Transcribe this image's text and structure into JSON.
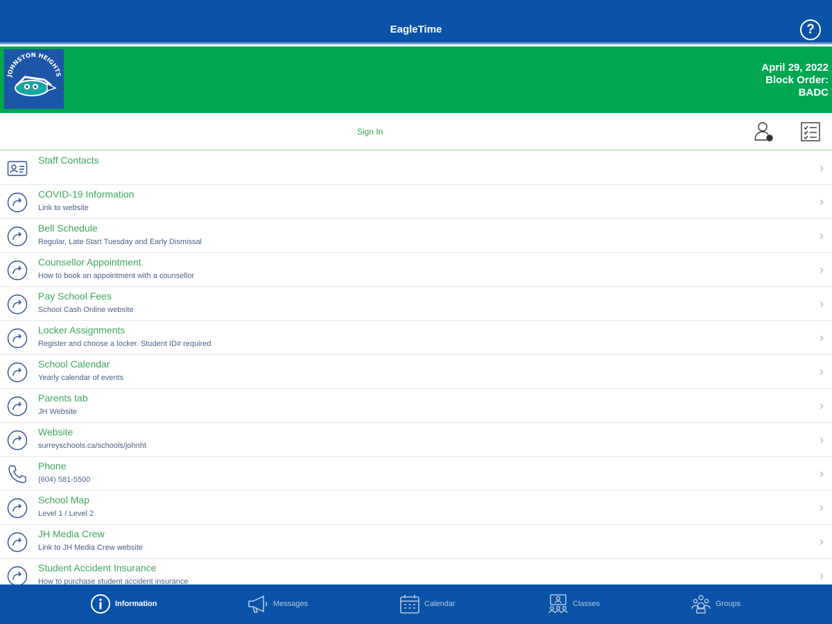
{
  "header": {
    "title": "EagleTime",
    "help_icon": "help-circle-icon"
  },
  "banner": {
    "logo_text": "JOHNSTON HEIGHTS",
    "date": "April 29, 2022",
    "block_order_label": "Block Order:",
    "block_order_value": "BADC"
  },
  "signin": {
    "label": "Sign In"
  },
  "items": [
    {
      "title": "Staff Contacts",
      "subtitle": "",
      "icon": "contact-card-icon"
    },
    {
      "title": "COVID-19 Information",
      "subtitle": "Link to website",
      "icon": "share-arrow-icon"
    },
    {
      "title": "Bell Schedule",
      "subtitle": "Regular, Late Start Tuesday and Early Dismissal",
      "icon": "share-arrow-icon"
    },
    {
      "title": "Counsellor Appointment",
      "subtitle": "How to book an appointment with a counsellor",
      "icon": "share-arrow-icon"
    },
    {
      "title": "Pay School Fees",
      "subtitle": "School Cash Online website",
      "icon": "share-arrow-icon"
    },
    {
      "title": "Locker Assignments",
      "subtitle": "Register and choose a locker. Student ID# required",
      "icon": "share-arrow-icon"
    },
    {
      "title": "School Calendar",
      "subtitle": "Yearly calendar of events",
      "icon": "share-arrow-icon"
    },
    {
      "title": "Parents tab",
      "subtitle": "JH Website",
      "icon": "share-arrow-icon"
    },
    {
      "title": "Website",
      "subtitle": "surreyschools.ca/schools/johnht",
      "icon": "share-arrow-icon"
    },
    {
      "title": "Phone",
      "subtitle": "(604) 581-5500",
      "icon": "phone-icon"
    },
    {
      "title": "School Map",
      "subtitle": "Level 1 / Level 2",
      "icon": "share-arrow-icon"
    },
    {
      "title": "JH Media Crew",
      "subtitle": "Link to JH Media Crew website",
      "icon": "share-arrow-icon"
    },
    {
      "title": "Student Accident Insurance",
      "subtitle": "How to purchase student accident insurance",
      "icon": "share-arrow-icon"
    }
  ],
  "tabs": [
    {
      "label": "Information",
      "icon": "info-icon",
      "active": true
    },
    {
      "label": "Messages",
      "icon": "megaphone-icon",
      "active": false
    },
    {
      "label": "Calendar",
      "icon": "calendar-icon",
      "active": false
    },
    {
      "label": "Classes",
      "icon": "classes-icon",
      "active": false
    },
    {
      "label": "Groups",
      "icon": "groups-icon",
      "active": false
    }
  ],
  "colors": {
    "primary_blue": "#0a52a8",
    "banner_green": "#00a651",
    "title_green": "#3aa85a"
  }
}
